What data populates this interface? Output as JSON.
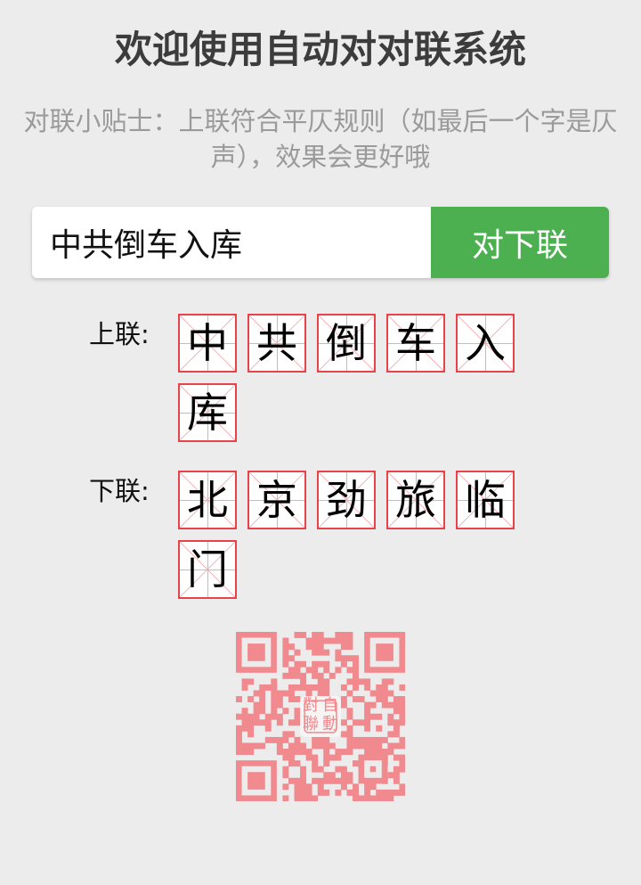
{
  "header": {
    "title": "欢迎使用自动对对联系统",
    "tip": "对联小贴士：上联符合平仄规则（如最后一个字是仄声），效果会更好哦"
  },
  "form": {
    "input_value": "中共倒车入库",
    "submit_label": "对下联"
  },
  "upper": {
    "label": "上联:",
    "chars": [
      "中",
      "共",
      "倒",
      "车",
      "入",
      "库"
    ]
  },
  "lower": {
    "label": "下联:",
    "chars": [
      "北",
      "京",
      "劲",
      "旅",
      "临",
      "门"
    ]
  },
  "qr": {
    "seal_text": "自動對聯",
    "color": "#f08a8e"
  }
}
